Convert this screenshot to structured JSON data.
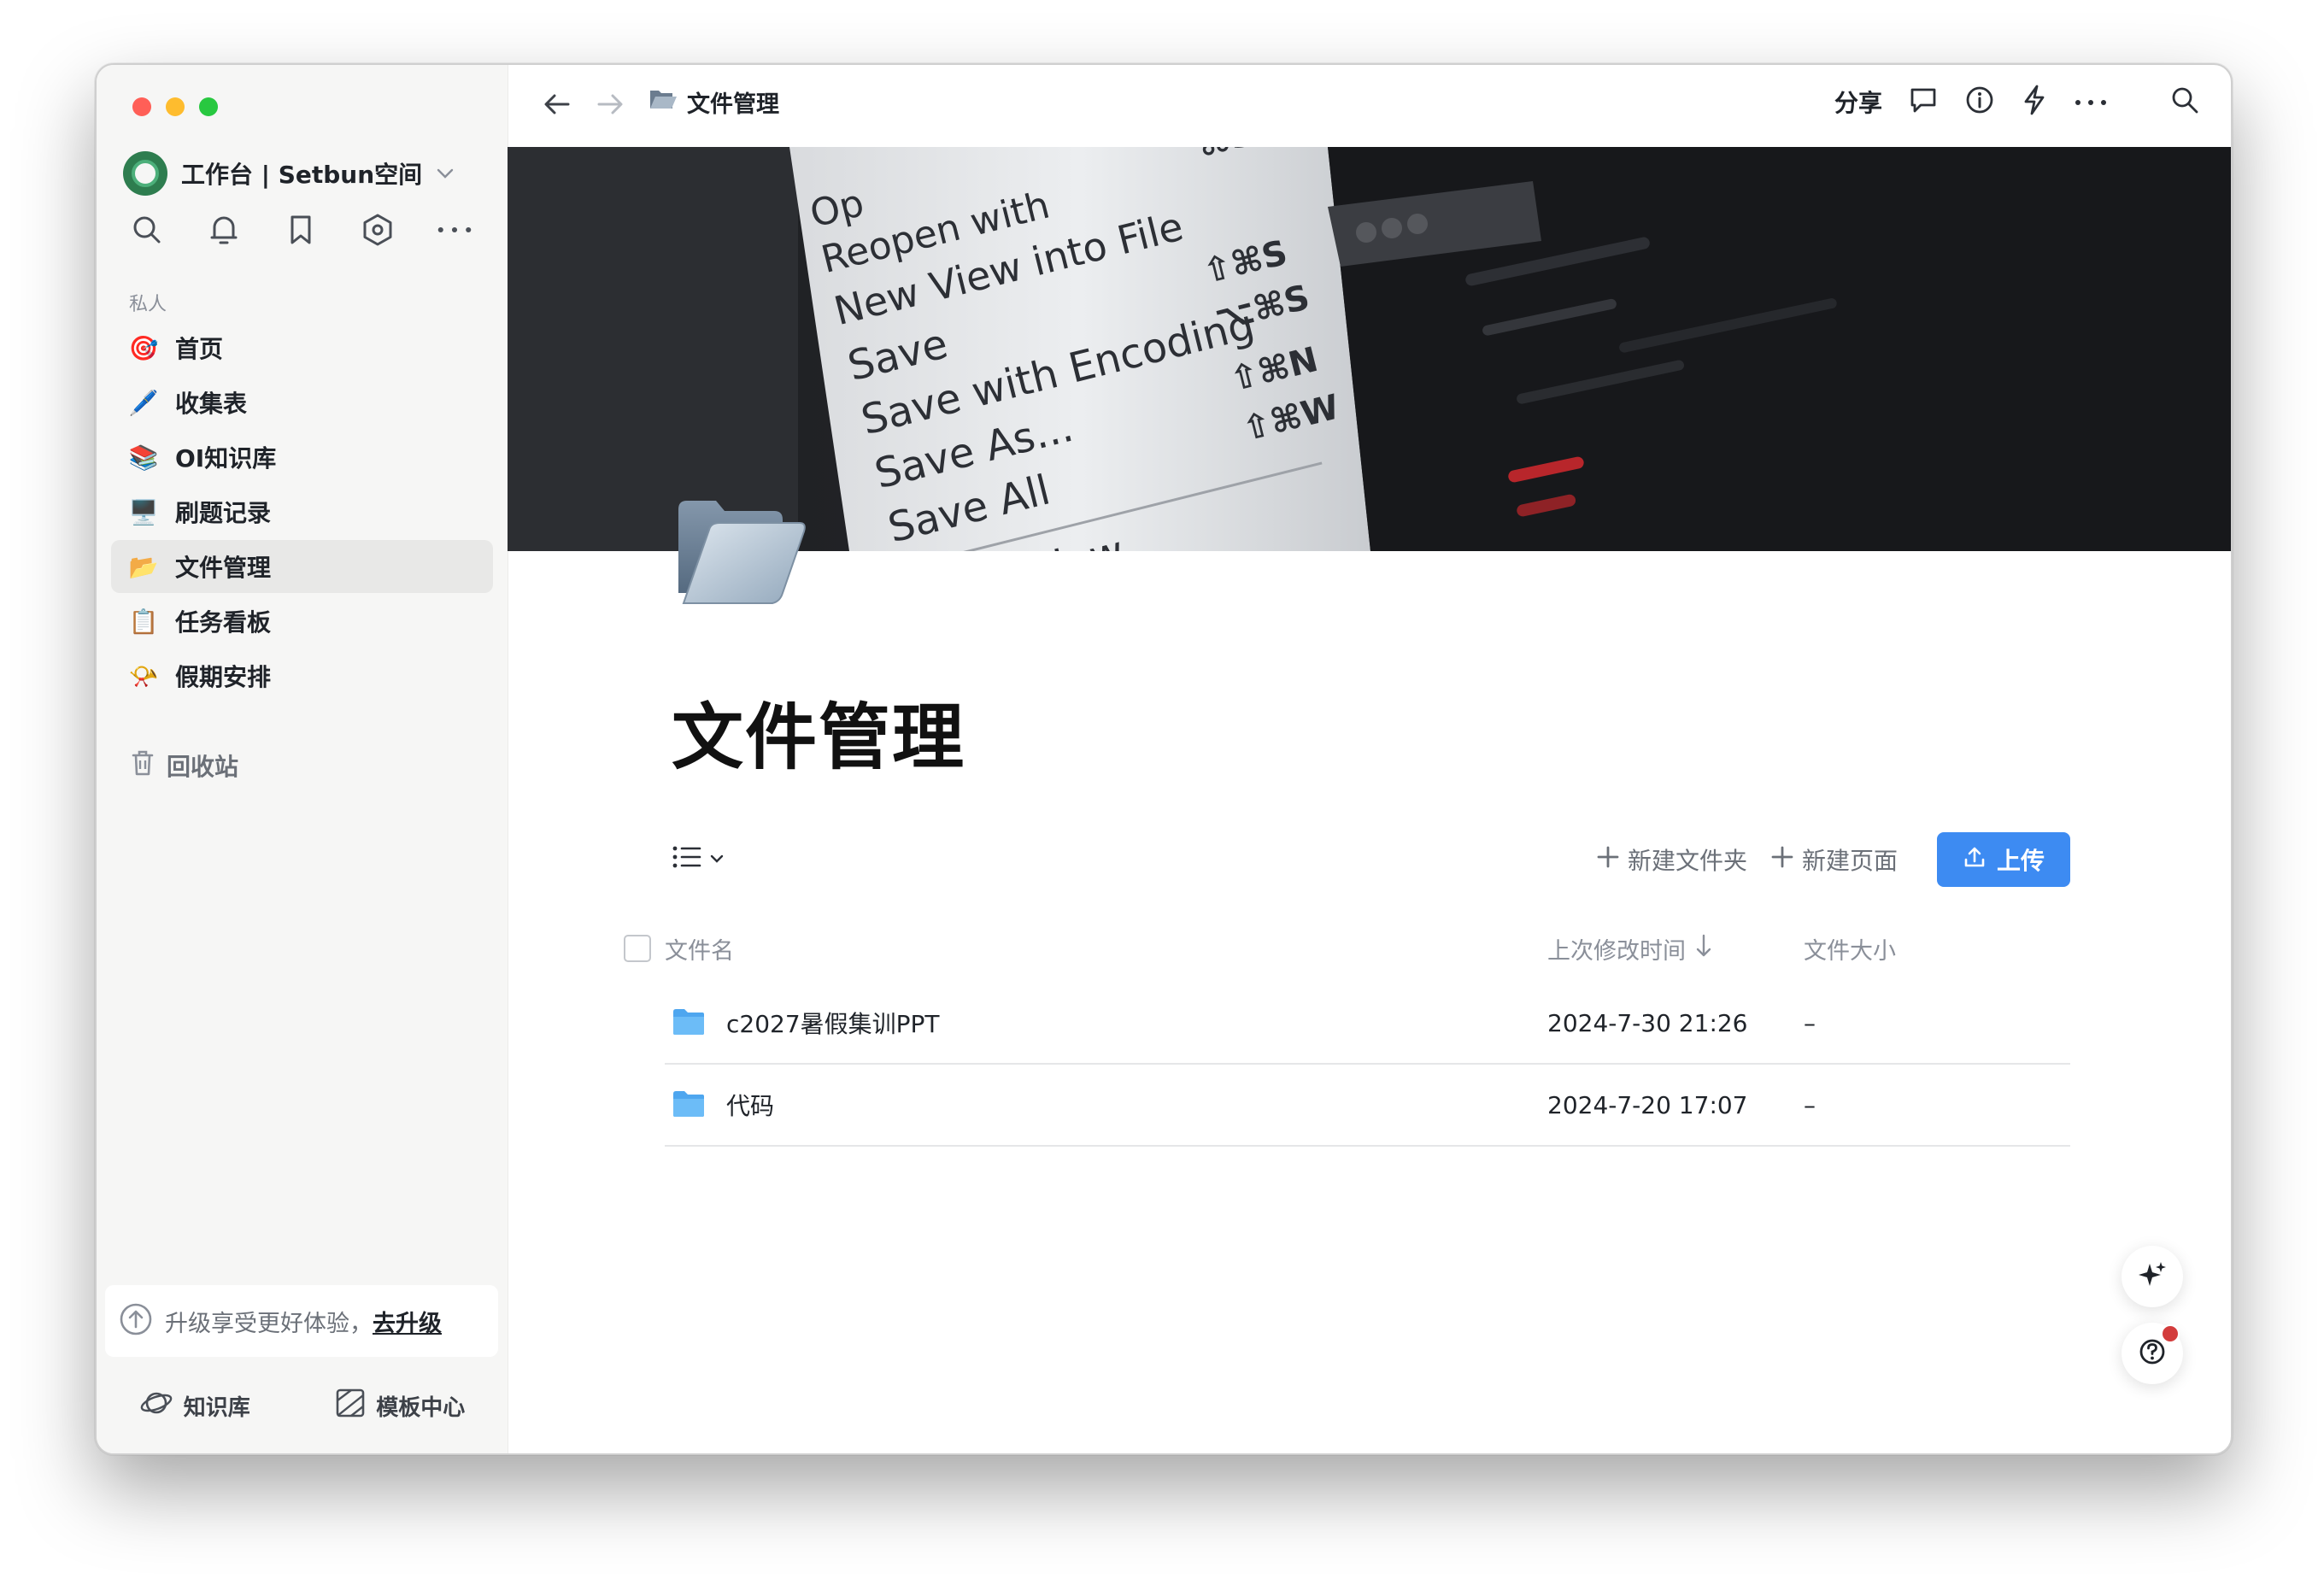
{
  "workspace": {
    "name": "工作台 | Setbun空间"
  },
  "sidebar": {
    "section_label": "私人",
    "items": [
      {
        "emoji": "🎯",
        "label": "首页",
        "active": false
      },
      {
        "emoji": "🖊️",
        "label": "收集表",
        "active": false
      },
      {
        "emoji": "📚",
        "label": "OI知识库",
        "active": false
      },
      {
        "emoji": "🖥️",
        "label": "刷题记录",
        "active": false
      },
      {
        "emoji": "📂",
        "label": "文件管理",
        "active": true
      },
      {
        "emoji": "📋",
        "label": "任务看板",
        "active": false
      },
      {
        "emoji": "📯",
        "label": "假期安排",
        "active": false
      }
    ],
    "trash_label": "回收站",
    "upgrade_text": "升级享受更好体验，",
    "upgrade_link": "去升级",
    "bottom": {
      "knowledge_label": "知识库",
      "template_label": "模板中心"
    }
  },
  "topbar": {
    "breadcrumb": "文件管理",
    "share_label": "分享"
  },
  "cover_text": {
    "line1": "Op",
    "line2": "Reopen with",
    "line3": "New View into File",
    "line4": "Save",
    "line5": "Save with Encoding",
    "line6": "Save As...",
    "line7": "Save All",
    "line8": "Window",
    "sc1": "⌘S",
    "sc2": "⇧⌘S",
    "sc3": "⌥⌘S",
    "sc4": "⇧⌘N",
    "sc5": "⇧⌘W"
  },
  "page": {
    "title": "文件管理"
  },
  "toolbar": {
    "new_folder_label": "新建文件夹",
    "new_page_label": "新建页面",
    "upload_label": "上传"
  },
  "table": {
    "columns": {
      "name": "文件名",
      "modified": "上次修改时间",
      "size": "文件大小"
    },
    "rows": [
      {
        "name": "c2027暑假集训PPT",
        "modified": "2024-7-30 21:26",
        "size": "–"
      },
      {
        "name": "代码",
        "modified": "2024-7-20 17:07",
        "size": "–"
      }
    ]
  },
  "colors": {
    "accent": "#3d8bf2",
    "folder": "#5ab4f5",
    "sidebar_bg": "#f6f6f5"
  }
}
